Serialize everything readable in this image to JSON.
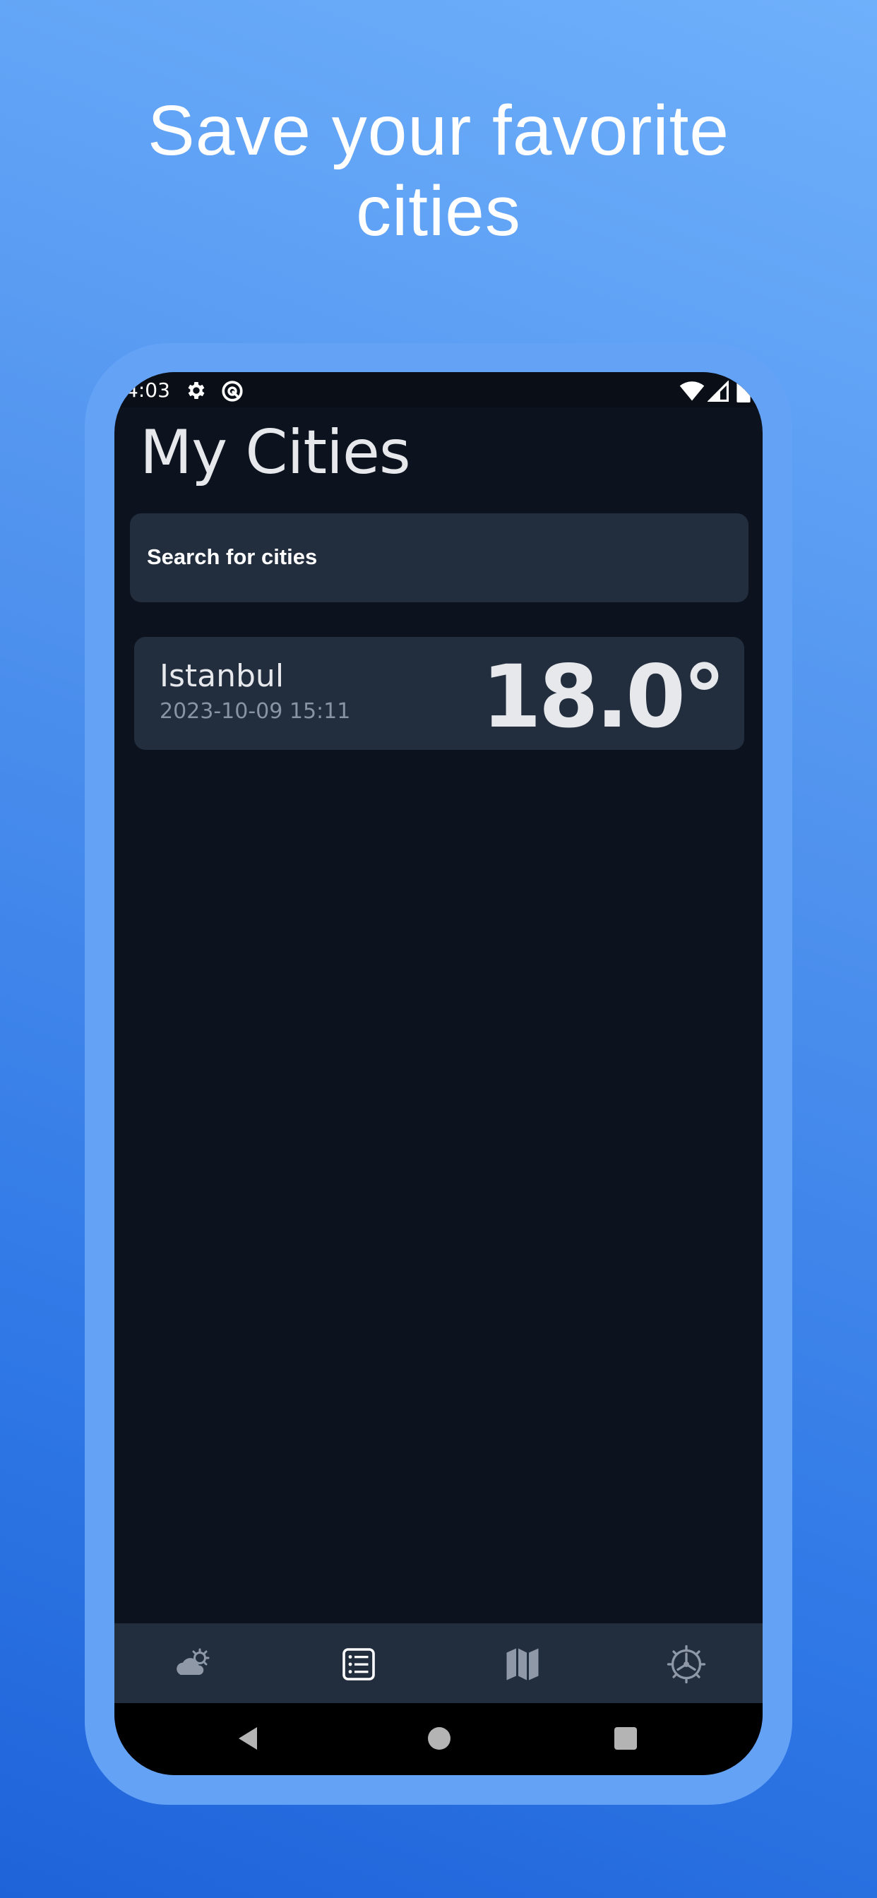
{
  "headline": {
    "line1": "Save your favorite",
    "line2": "cities"
  },
  "status_bar": {
    "time": "4:03",
    "icons": [
      "settings-gear-icon",
      "vpn-icon",
      "wifi-icon",
      "cell-signal-icon",
      "battery-icon"
    ]
  },
  "screen": {
    "title": "My Cities",
    "search": {
      "placeholder": "Search for cities"
    },
    "cities": [
      {
        "name": "Istanbul",
        "datetime": "2023-10-09 15:11",
        "temperature": "18.0°"
      }
    ]
  },
  "bottom_nav": {
    "items": [
      {
        "icon": "weather-icon",
        "active": false
      },
      {
        "icon": "list-icon",
        "active": true
      },
      {
        "icon": "map-icon",
        "active": false
      },
      {
        "icon": "settings-icon",
        "active": false
      }
    ]
  },
  "system_nav": [
    "back-icon",
    "home-icon",
    "recents-icon"
  ],
  "colors": {
    "background_gradient_top": "#6fb0fb",
    "background_gradient_bottom": "#1f63d9",
    "phone_frame": "#64a2f6",
    "screen_bg": "#0d131e",
    "card_bg": "#222d3d",
    "text_primary": "#e6e8ec",
    "text_secondary": "#8a93a2"
  }
}
